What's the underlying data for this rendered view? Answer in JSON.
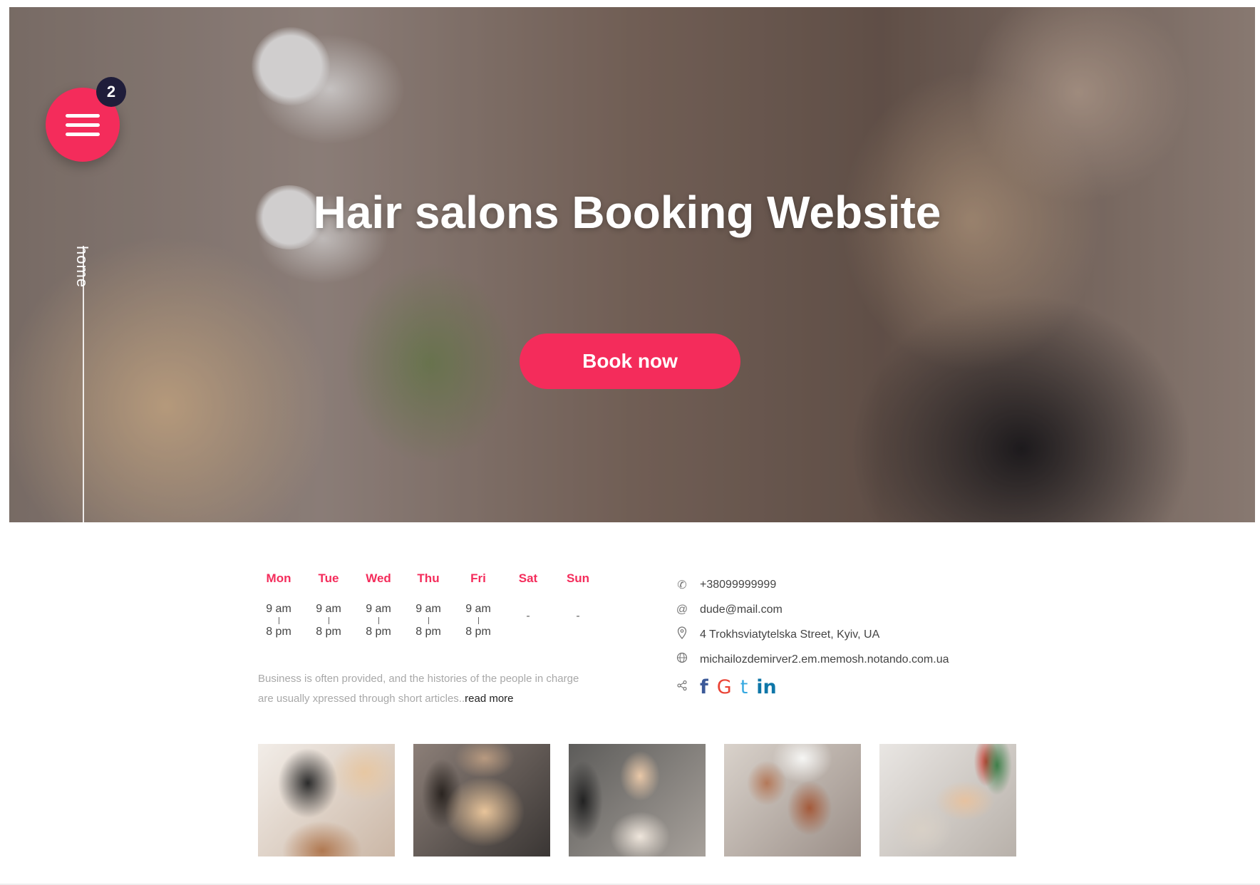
{
  "hero": {
    "title": "Hair salons Booking Website",
    "book_label": "Book now",
    "menu_badge_count": "2",
    "side_label": "home"
  },
  "schedule": [
    {
      "day": "Mon",
      "open": "9 am",
      "close": "8 pm"
    },
    {
      "day": "Tue",
      "open": "9 am",
      "close": "8 pm"
    },
    {
      "day": "Wed",
      "open": "9 am",
      "close": "8 pm"
    },
    {
      "day": "Thu",
      "open": "9 am",
      "close": "8 pm"
    },
    {
      "day": "Fri",
      "open": "9 am",
      "close": "8 pm"
    },
    {
      "day": "Sat",
      "closed": "-"
    },
    {
      "day": "Sun",
      "closed": "-"
    }
  ],
  "description": {
    "text": "Business is often provided, and the histories of the people in charge are usually xpressed through short articles..",
    "read_more": "read more"
  },
  "contacts": {
    "phone": "+38099999999",
    "email": "dude@mail.com",
    "address": "4 Trokhsviatytelska Street, Kyiv, UA",
    "website": "michailozdemirver2.em.memosh.notando.com.ua"
  },
  "icons": {
    "phone": "phone-icon",
    "email": "at-icon",
    "address": "map-pin-icon",
    "website": "globe-icon",
    "share": "share-icon"
  },
  "social": [
    {
      "name": "facebook",
      "glyph": "f",
      "color": "#3b5998"
    },
    {
      "name": "google",
      "glyph": "G",
      "color": "#ea4335"
    },
    {
      "name": "tumblr",
      "glyph": "t",
      "color": "#36a9e1"
    },
    {
      "name": "linkedin",
      "glyph": "in",
      "color": "#0e76a8"
    }
  ],
  "colors": {
    "accent": "#f42c5b",
    "badge": "#1f1d3a"
  }
}
